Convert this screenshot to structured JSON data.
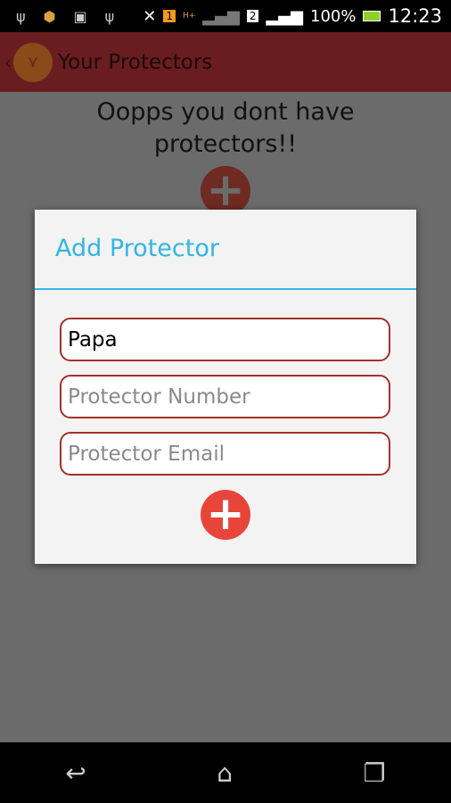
{
  "status_bar": {
    "battery": "100%",
    "time": "12:23",
    "sim1": "1",
    "sim2": "2",
    "network": "H+"
  },
  "app_bar": {
    "title": "Your Protectors"
  },
  "background": {
    "message": "Oopps you dont have protectors!!"
  },
  "dialog": {
    "title": "Add Protector",
    "name_value": "Papa",
    "number_placeholder": "Protector Number",
    "email_placeholder": "Protector Email"
  },
  "colors": {
    "accent": "#33b5e5",
    "brand": "#a3302b",
    "add_button": "#e8453a"
  }
}
